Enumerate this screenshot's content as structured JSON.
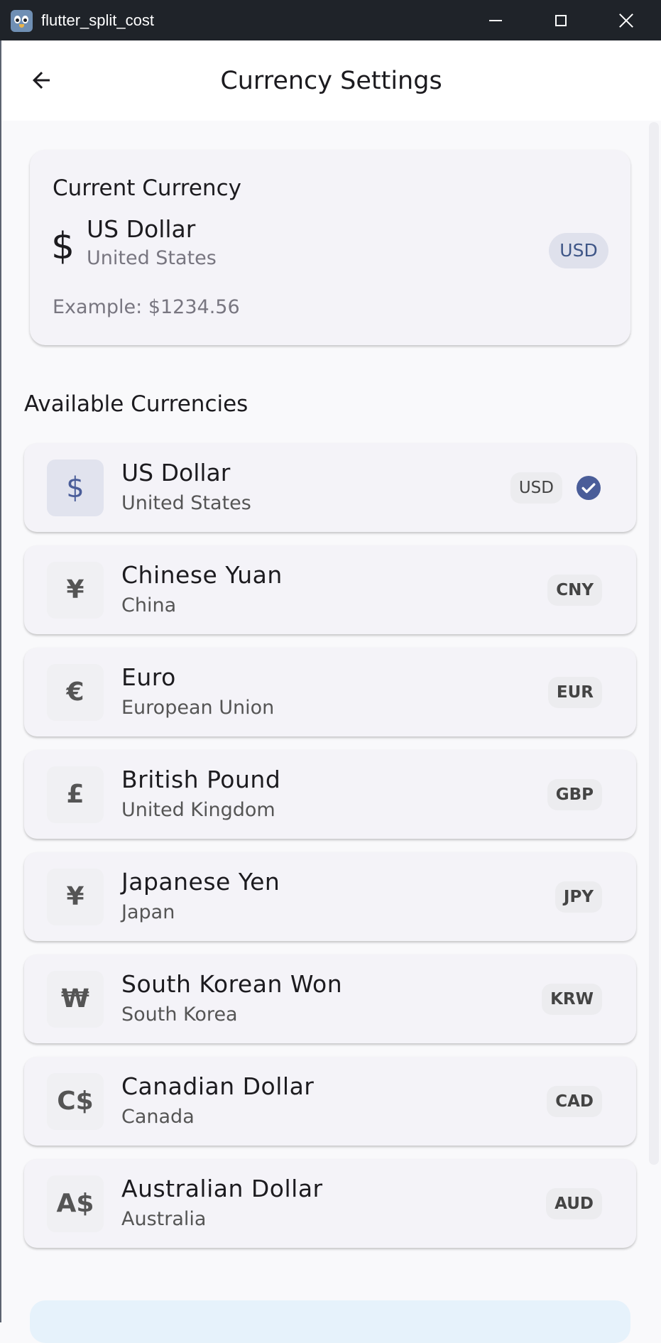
{
  "window": {
    "title": "flutter_split_cost"
  },
  "appbar": {
    "title": "Currency Settings"
  },
  "current": {
    "heading": "Current Currency",
    "symbol": "$",
    "name": "US Dollar",
    "country": "United States",
    "code": "USD",
    "example": "Example: $1234.56"
  },
  "available": {
    "heading": "Available Currencies",
    "items": [
      {
        "symbol": "$",
        "name": "US Dollar",
        "country": "United States",
        "code": "USD",
        "selected": true
      },
      {
        "symbol": "¥",
        "name": "Chinese Yuan",
        "country": "China",
        "code": "CNY",
        "selected": false
      },
      {
        "symbol": "€",
        "name": "Euro",
        "country": "European Union",
        "code": "EUR",
        "selected": false
      },
      {
        "symbol": "£",
        "name": "British Pound",
        "country": "United Kingdom",
        "code": "GBP",
        "selected": false
      },
      {
        "symbol": "¥",
        "name": "Japanese Yen",
        "country": "Japan",
        "code": "JPY",
        "selected": false
      },
      {
        "symbol": "₩",
        "name": "South Korean Won",
        "country": "South Korea",
        "code": "KRW",
        "selected": false
      },
      {
        "symbol": "C$",
        "name": "Canadian Dollar",
        "country": "Canada",
        "code": "CAD",
        "selected": false
      },
      {
        "symbol": "A$",
        "name": "Australian Dollar",
        "country": "Australia",
        "code": "AUD",
        "selected": false
      }
    ]
  },
  "colors": {
    "titlebar": "#1f2329",
    "accent": "#4a5d99",
    "card": "#f4f3f8",
    "background": "#f9f9fb"
  },
  "icons": {
    "back": "arrow-back-icon",
    "selected": "check-circle-icon",
    "minimize": "minimize-icon",
    "maximize": "maximize-icon",
    "close": "close-icon"
  }
}
